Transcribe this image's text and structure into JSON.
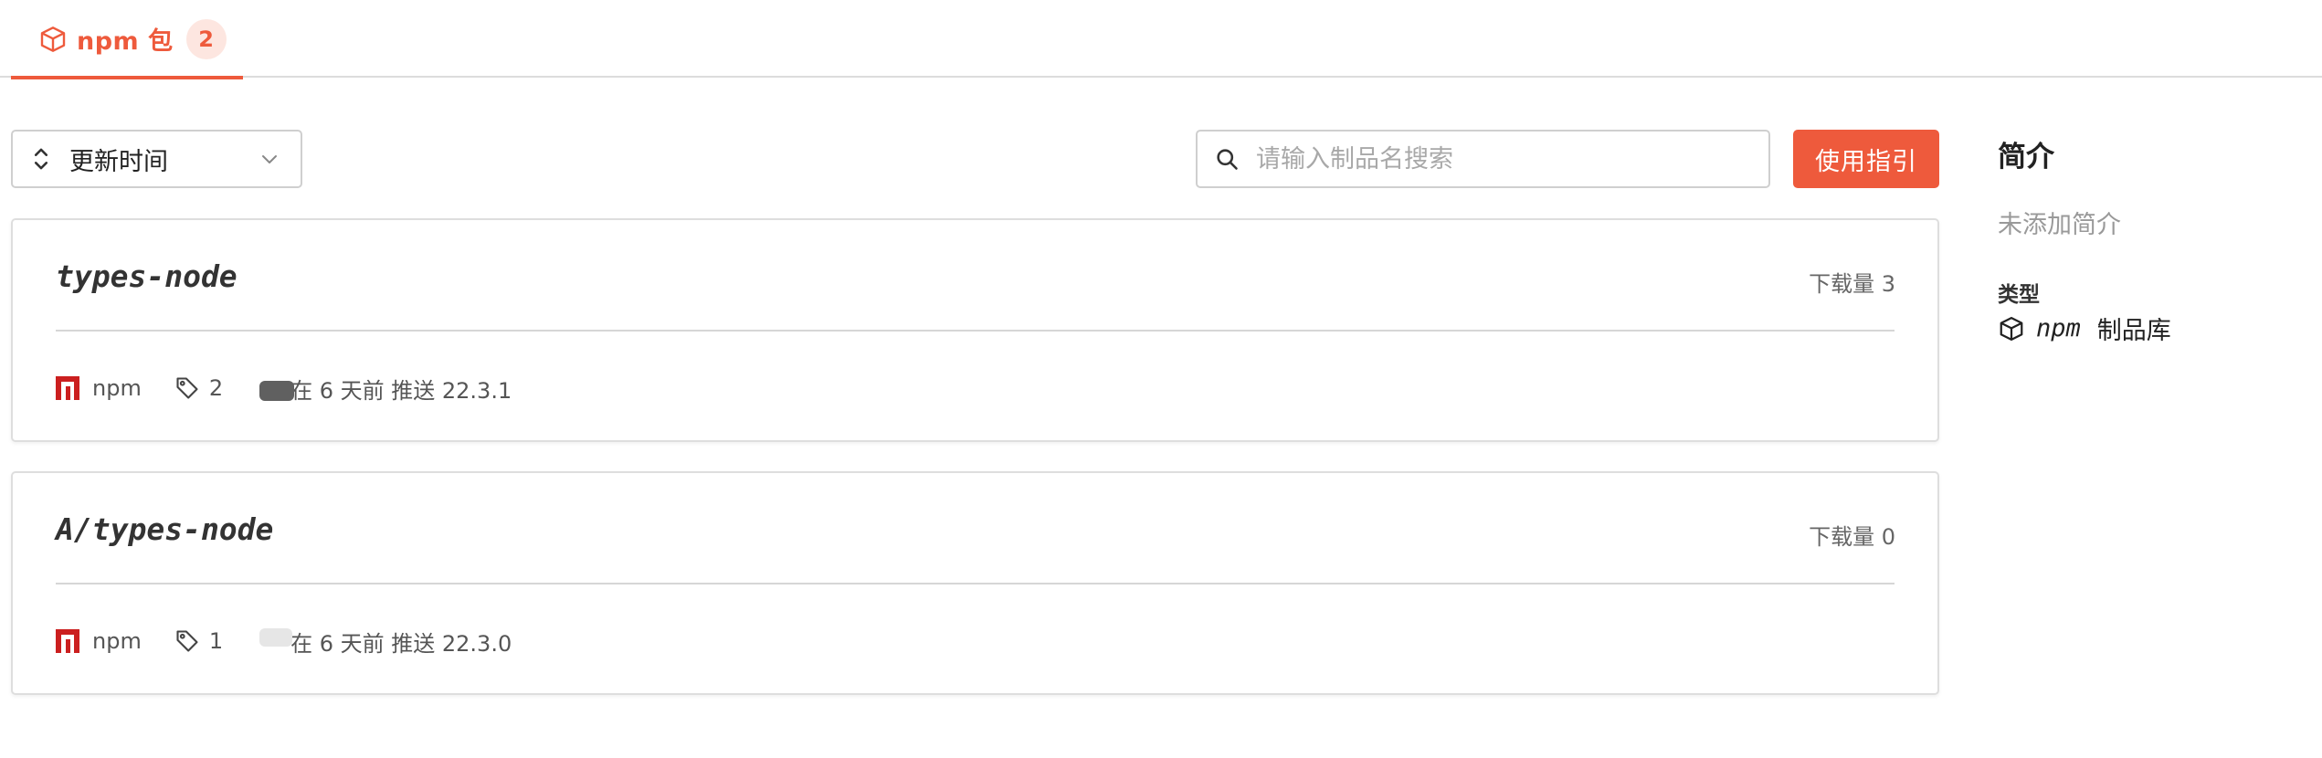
{
  "tabs": [
    {
      "label": "npm 包",
      "count": "2",
      "icon": "package-icon",
      "active": true
    }
  ],
  "toolbar": {
    "sort_label": "更新时间",
    "search_placeholder": "请输入制品名搜索",
    "search_value": "",
    "guide_label": "使用指引"
  },
  "packages": [
    {
      "name": "types-node",
      "downloads": "下载量 3",
      "registry": "npm",
      "tag_count": "2",
      "pushed": "在 6 天前 推送 22.3.1"
    },
    {
      "name": "A/types-node",
      "downloads": "下载量 0",
      "registry": "npm",
      "tag_count": "1",
      "pushed": "在 6 天前 推送 22.3.0"
    }
  ],
  "sidebar": {
    "title": "简介",
    "description": "未添加简介",
    "type_label": "类型",
    "type_prefix": "npm",
    "type_value": "制品库"
  },
  "colors": {
    "accent": "#ee5a3c",
    "npm_red": "#cb1f1f",
    "border": "#dedede"
  }
}
